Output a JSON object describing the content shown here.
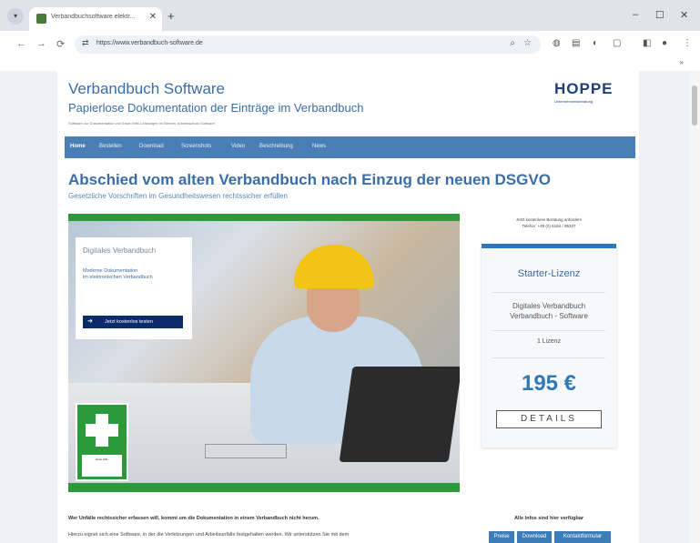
{
  "browser": {
    "tab_title": "Verbandbuchsoftware elektr...",
    "url": "https://www.verbandbuch-software.de",
    "new_tab": "+",
    "close_tab": "✕",
    "minimize": "–",
    "maximize": "☐",
    "close_window": "✕",
    "bookmarks_more": "»"
  },
  "site": {
    "title": "Verbandbuch Software",
    "subtitle": "Papierlose Dokumentation der Einträge im Verbandbuch",
    "tagline": "Software zur Dokumentation von Erste-Hilfe-Leistungen im Betrieb. Arbeitsschutz-Software",
    "logo": "HOPPE",
    "logo_sub": "Unternehmensberatung"
  },
  "nav": [
    "Home",
    "Bestellen",
    "Download",
    "Screenshots",
    "Video",
    "Beschreibung",
    "News"
  ],
  "main": {
    "headline": "Abschied vom alten Verbandbuch nach Einzug der neuen DSGVO",
    "subheadline": "Gesetzliche Vorschriften im Gesundheitswesen rechtssicher erfüllen"
  },
  "promo": {
    "title": "Digitales Verbandbuch",
    "text_line1": "Moderne Dokumentation",
    "text_line2": "im elektronischen Verbandbuch",
    "button": "Jetzt kostenlos testen",
    "sign_label": "Erste Hilfe"
  },
  "sidebar": {
    "info_line1": "Jetzt kostenlose Beratung anfordern",
    "info_line2": "Telefon: +49 (0) 6184 / 95327"
  },
  "pricing": {
    "title": "Starter-Lizenz",
    "desc_line1": "Digitales Verbandbuch",
    "desc_line2": "Verbandbuch - Software",
    "licenses": "1 Lizenz",
    "price": "195 €",
    "button": "DETAILS"
  },
  "footer": {
    "body_head": "Wer Unfälle rechtssicher erfassen will, kommt um die Dokumentation in einem Verbandbuch nicht herum.",
    "body_text": "Hierzu eignet sich eine Software, in der die Verletzungen und Arbeitsunfälle festgehalten werden. Wir unterstützen Sie mit dem",
    "links_head": "Alle Infos sind hier verfügbar",
    "links": [
      "Preise",
      "Download",
      "Kontaktformular"
    ]
  },
  "colors": {
    "accent": "#3a6ea5",
    "nav_bg": "#4a7fb5",
    "green": "#2c9a3a",
    "price_blue": "#2f79b9"
  }
}
